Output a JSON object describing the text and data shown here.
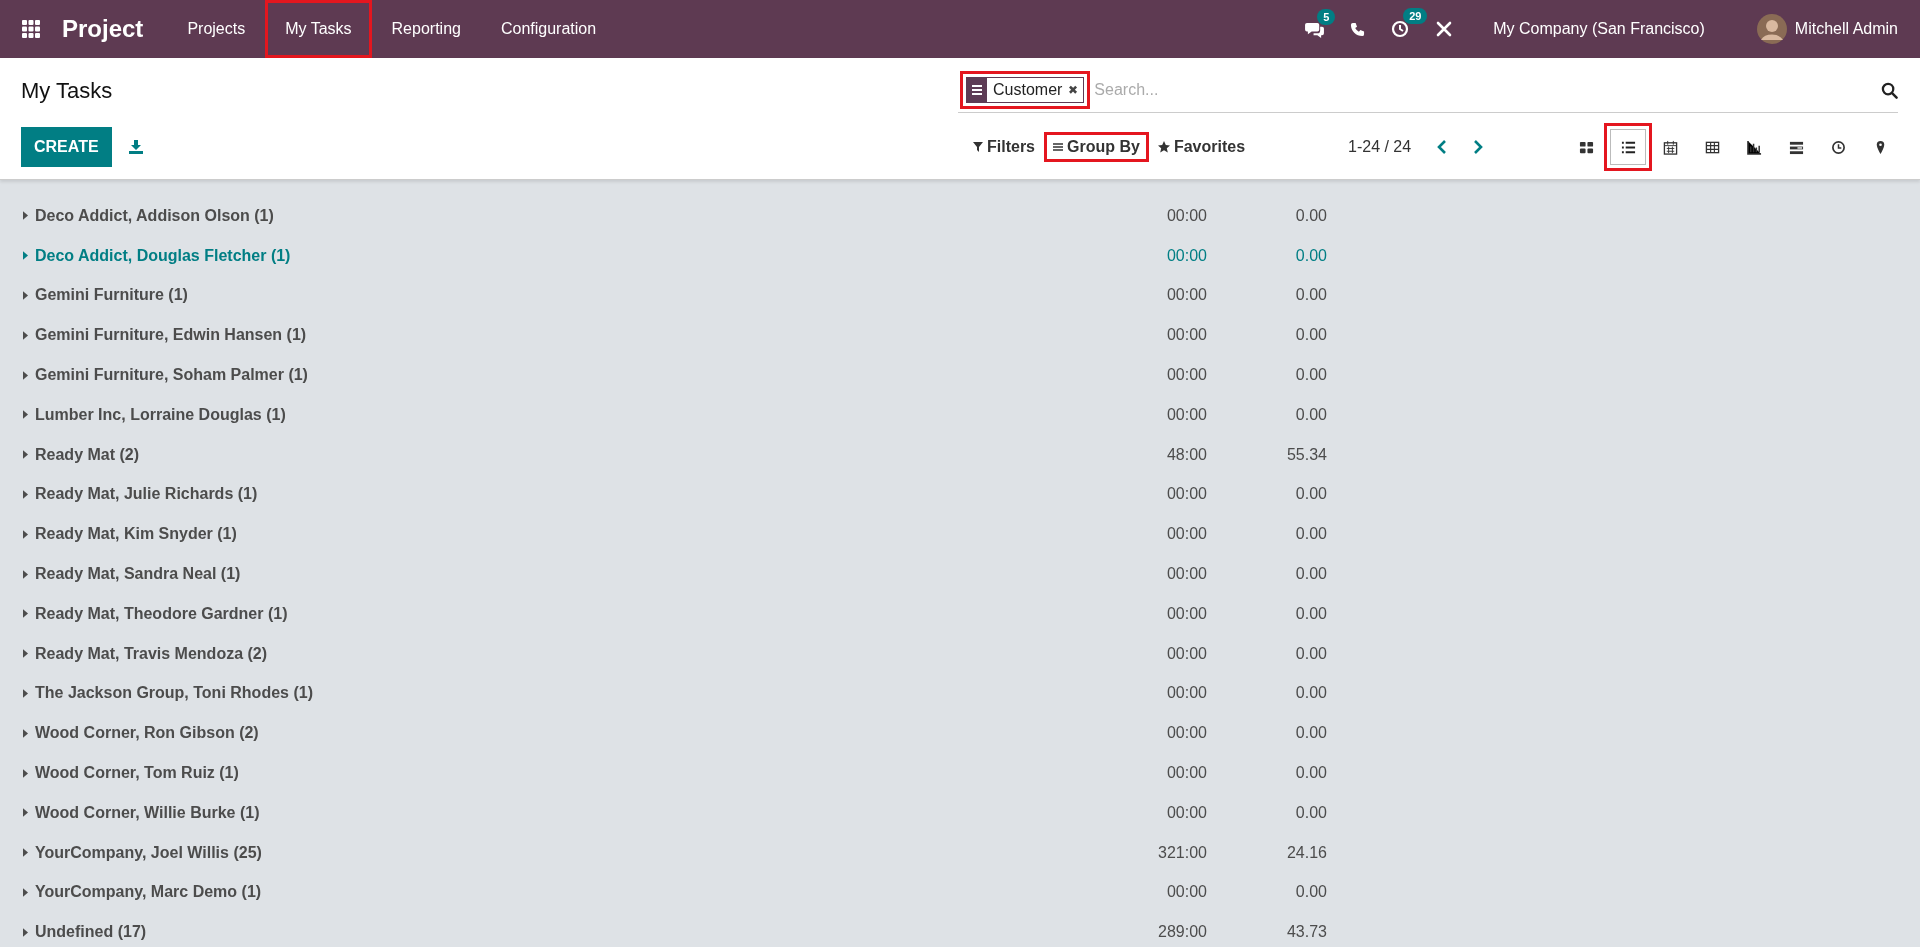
{
  "navbar": {
    "app_name": "Project",
    "menu": [
      {
        "label": "Projects",
        "highlighted": false
      },
      {
        "label": "My Tasks",
        "highlighted": true
      },
      {
        "label": "Reporting",
        "highlighted": false
      },
      {
        "label": "Configuration",
        "highlighted": false
      }
    ],
    "messages_count": "5",
    "activities_count": "29",
    "company": "My Company (San Francisco)",
    "user": "Mitchell Admin"
  },
  "control_panel": {
    "title": "My Tasks",
    "create_button": "CREATE",
    "search": {
      "facet": "Customer",
      "facet_highlighted": true,
      "remove": "✖",
      "placeholder": "Search..."
    },
    "filters": "Filters",
    "group_by": "Group By",
    "group_by_highlighted": true,
    "favorites": "Favorites",
    "pager": "1-24 / 24",
    "views": [
      {
        "kind": "kanban",
        "selected": false
      },
      {
        "kind": "list",
        "selected": true
      },
      {
        "kind": "calendar",
        "selected": false
      },
      {
        "kind": "pivot",
        "selected": false
      },
      {
        "kind": "graph",
        "selected": false
      },
      {
        "kind": "gantt",
        "selected": false
      },
      {
        "kind": "activity",
        "selected": false
      },
      {
        "kind": "map",
        "selected": false
      }
    ]
  },
  "groups": [
    {
      "name": "Deco Addict, Addison Olson (1)",
      "hours": "00:00",
      "progress": "0.00",
      "hovered": false
    },
    {
      "name": "Deco Addict, Douglas Fletcher (1)",
      "hours": "00:00",
      "progress": "0.00",
      "hovered": true
    },
    {
      "name": "Gemini Furniture (1)",
      "hours": "00:00",
      "progress": "0.00",
      "hovered": false
    },
    {
      "name": "Gemini Furniture, Edwin Hansen (1)",
      "hours": "00:00",
      "progress": "0.00",
      "hovered": false
    },
    {
      "name": "Gemini Furniture, Soham Palmer (1)",
      "hours": "00:00",
      "progress": "0.00",
      "hovered": false
    },
    {
      "name": "Lumber Inc, Lorraine Douglas (1)",
      "hours": "00:00",
      "progress": "0.00",
      "hovered": false
    },
    {
      "name": "Ready Mat (2)",
      "hours": "48:00",
      "progress": "55.34",
      "hovered": false
    },
    {
      "name": "Ready Mat, Julie Richards (1)",
      "hours": "00:00",
      "progress": "0.00",
      "hovered": false
    },
    {
      "name": "Ready Mat, Kim Snyder (1)",
      "hours": "00:00",
      "progress": "0.00",
      "hovered": false
    },
    {
      "name": "Ready Mat, Sandra Neal (1)",
      "hours": "00:00",
      "progress": "0.00",
      "hovered": false
    },
    {
      "name": "Ready Mat, Theodore Gardner (1)",
      "hours": "00:00",
      "progress": "0.00",
      "hovered": false
    },
    {
      "name": "Ready Mat, Travis Mendoza (2)",
      "hours": "00:00",
      "progress": "0.00",
      "hovered": false
    },
    {
      "name": "The Jackson Group, Toni Rhodes (1)",
      "hours": "00:00",
      "progress": "0.00",
      "hovered": false
    },
    {
      "name": "Wood Corner, Ron Gibson (2)",
      "hours": "00:00",
      "progress": "0.00",
      "hovered": false
    },
    {
      "name": "Wood Corner, Tom Ruiz (1)",
      "hours": "00:00",
      "progress": "0.00",
      "hovered": false
    },
    {
      "name": "Wood Corner, Willie Burke (1)",
      "hours": "00:00",
      "progress": "0.00",
      "hovered": false
    },
    {
      "name": "YourCompany, Joel Willis (25)",
      "hours": "321:00",
      "progress": "24.16",
      "hovered": false
    },
    {
      "name": "YourCompany, Marc Demo (1)",
      "hours": "00:00",
      "progress": "0.00",
      "hovered": false
    },
    {
      "name": "Undefined (17)",
      "hours": "289:00",
      "progress": "43.73",
      "hovered": false
    }
  ]
}
